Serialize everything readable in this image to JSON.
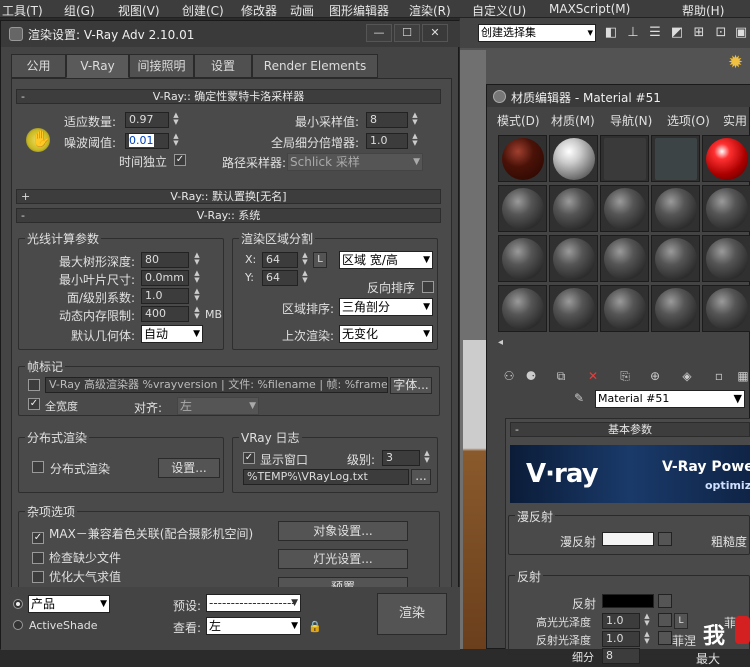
{
  "app_menu": [
    "工具(T)",
    "组(G)",
    "视图(V)",
    "创建(C)",
    "修改器",
    "动画",
    "图形编辑器",
    "渲染(R)",
    "自定义(U)",
    "MAXScript(M)",
    "帮助(H)"
  ],
  "toolbar": {
    "selection_set": "创建选择集"
  },
  "render_dialog": {
    "title": "渲染设置: V-Ray Adv 2.10.01",
    "tabs": [
      "公用",
      "V-Ray",
      "间接照明",
      "设置",
      "Render Elements"
    ],
    "sampler": {
      "header": "V-Ray:: 确定性蒙特卡洛采样器",
      "adaptive_amount_label": "适应数量:",
      "adaptive_amount": "0.97",
      "noise_threshold_label": "噪波阈值:",
      "noise_threshold": "0.01",
      "time_independent_label": "时间独立",
      "min_samples_label": "最小采样值:",
      "min_samples": "8",
      "global_subdivs_label": "全局细分倍增器:",
      "global_subdivs": "1.0",
      "path_sampler_label": "路径采样器:",
      "path_sampler": "Schlick 采样"
    },
    "displacement_header": "V-Ray:: 默认置换[无名]",
    "system": {
      "header": "V-Ray:: 系统",
      "raycaster_group": "光线计算参数",
      "max_tree_depth_label": "最大树形深度:",
      "max_tree_depth": "80",
      "min_leaf_label": "最小叶片尺寸:",
      "min_leaf": "0.0mm",
      "face_coef_label": "面/级别系数:",
      "face_coef": "1.0",
      "mem_limit_label": "动态内存限制:",
      "mem_limit": "400",
      "mem_unit": "MB",
      "default_geom_label": "默认几何体:",
      "default_geom": "自动",
      "region_group": "渲染区域分割",
      "x_label": "X:",
      "x_val": "64",
      "y_label": "Y:",
      "y_val": "64",
      "lock": "L",
      "region_mode": "区域 宽/高",
      "reverse_label": "反向排序",
      "region_seq_label": "区域排序:",
      "region_seq": "三角剖分",
      "prev_render_label": "上次渲染:",
      "prev_render": "无变化",
      "frame_stamp_group": "帧标记",
      "stamp_text": "V-Ray 高级渲染器 %vrayversion | 文件: %filename | 帧: %frame | 基",
      "font_button": "字体...",
      "full_width_label": "全宽度",
      "justify_label": "对齐:",
      "justify": "左",
      "distributed_group": "分布式渲染",
      "distributed_label": "分布式渲染",
      "settings_button": "设置...",
      "log_group": "VRay 日志",
      "show_window_label": "显示窗口",
      "level_label": "级别:",
      "level": "3",
      "log_path": "%TEMP%\\VRayLog.txt",
      "log_browse": "...",
      "misc_group": "杂项选项",
      "max_compat_label": "MAX－兼容着色关联(配合摄影机空间)",
      "object_settings_button": "对象设置...",
      "check_missing_label": "检查缺少文件",
      "light_settings_button": "灯光设置...",
      "optimize_atmo_label": "优化大气求值",
      "presets_button": "预置"
    },
    "bottom": {
      "mode_product": "产品",
      "mode_activeshade": "ActiveShade",
      "preset_label": "预设:",
      "preset": "--------------------",
      "view_label": "查看:",
      "view": "左",
      "render_button": "渲染"
    }
  },
  "material_editor": {
    "title": "材质编辑器 - Material #51",
    "menu": [
      "模式(D)",
      "材质(M)",
      "导航(N)",
      "选项(O)",
      "实用"
    ],
    "material_name": "Material #51",
    "basic_params_header": "基本参数",
    "banner_logo": "V·ray",
    "banner_power": "V-Ray Powe",
    "banner_optimized": "optimize",
    "diffuse_group": "漫反射",
    "diffuse_label": "漫反射",
    "roughness_label": "粗糙度",
    "reflection_group": "反射",
    "reflect_label": "反射",
    "hilight_gloss_label": "高光光泽度",
    "hilight_gloss": "1.0",
    "lock": "L",
    "fresnel_label": "菲涅",
    "refl_gloss_label": "反射光泽度",
    "refl_gloss": "1.0",
    "fresnel2_label": "菲涅",
    "subdivs_label": "细分",
    "subdivs": "8",
    "max_depth_label": "最大"
  },
  "watermark": "我"
}
